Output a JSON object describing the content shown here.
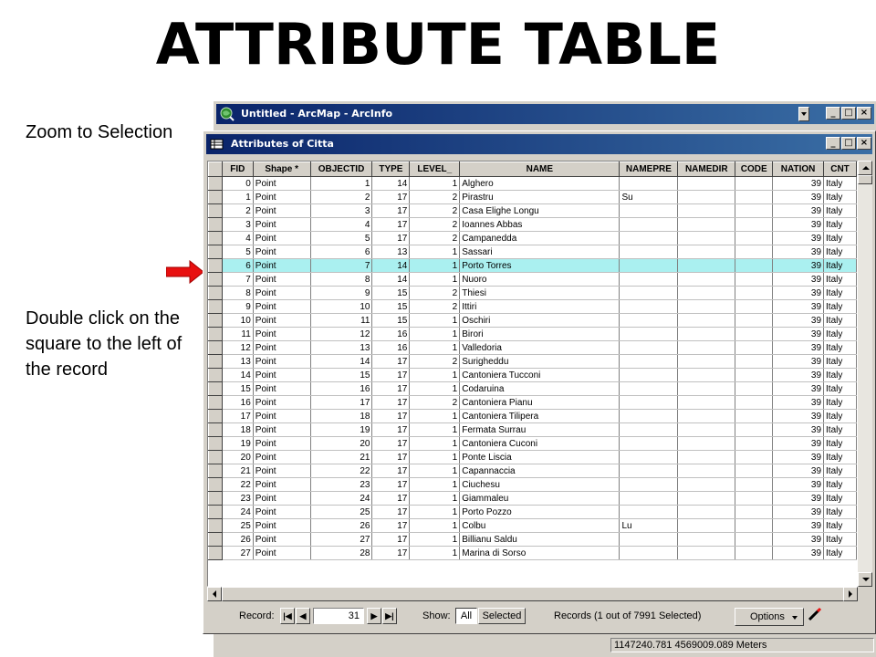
{
  "slide": {
    "title": "ATTRIBUTE TABLE",
    "note_zoom": "Zoom to Selection",
    "note_dblclick": "Double click on the square to the left of the record"
  },
  "arcmap": {
    "title": "Untitled - ArcMap - ArcInfo"
  },
  "attributes": {
    "title": "Attributes of Citta",
    "columns": [
      "FID",
      "Shape *",
      "OBJECTID",
      "TYPE",
      "LEVEL_",
      "NAME",
      "NAMEPRE",
      "NAMEDIR",
      "CODE",
      "NATION",
      "CNT"
    ],
    "rows": [
      [
        "0",
        "Point",
        "1",
        "14",
        "1",
        "Alghero",
        "",
        "",
        "",
        "39",
        "Italy"
      ],
      [
        "1",
        "Point",
        "2",
        "17",
        "2",
        "Pirastru",
        "Su",
        "",
        "",
        "39",
        "Italy"
      ],
      [
        "2",
        "Point",
        "3",
        "17",
        "2",
        "Casa Elighe Longu",
        "",
        "",
        "",
        "39",
        "Italy"
      ],
      [
        "3",
        "Point",
        "4",
        "17",
        "2",
        "Ioannes Abbas",
        "",
        "",
        "",
        "39",
        "Italy"
      ],
      [
        "4",
        "Point",
        "5",
        "17",
        "2",
        "Campanedda",
        "",
        "",
        "",
        "39",
        "Italy"
      ],
      [
        "5",
        "Point",
        "6",
        "13",
        "1",
        "Sassari",
        "",
        "",
        "",
        "39",
        "Italy"
      ],
      [
        "6",
        "Point",
        "7",
        "14",
        "1",
        "Porto Torres",
        "",
        "",
        "",
        "39",
        "Italy"
      ],
      [
        "7",
        "Point",
        "8",
        "14",
        "1",
        "Nuoro",
        "",
        "",
        "",
        "39",
        "Italy"
      ],
      [
        "8",
        "Point",
        "9",
        "15",
        "2",
        "Thiesi",
        "",
        "",
        "",
        "39",
        "Italy"
      ],
      [
        "9",
        "Point",
        "10",
        "15",
        "2",
        "Ittiri",
        "",
        "",
        "",
        "39",
        "Italy"
      ],
      [
        "10",
        "Point",
        "11",
        "15",
        "1",
        "Oschiri",
        "",
        "",
        "",
        "39",
        "Italy"
      ],
      [
        "11",
        "Point",
        "12",
        "16",
        "1",
        "Birori",
        "",
        "",
        "",
        "39",
        "Italy"
      ],
      [
        "12",
        "Point",
        "13",
        "16",
        "1",
        "Valledoria",
        "",
        "",
        "",
        "39",
        "Italy"
      ],
      [
        "13",
        "Point",
        "14",
        "17",
        "2",
        "Surigheddu",
        "",
        "",
        "",
        "39",
        "Italy"
      ],
      [
        "14",
        "Point",
        "15",
        "17",
        "1",
        "Cantoniera Tucconi",
        "",
        "",
        "",
        "39",
        "Italy"
      ],
      [
        "15",
        "Point",
        "16",
        "17",
        "1",
        "Codaruina",
        "",
        "",
        "",
        "39",
        "Italy"
      ],
      [
        "16",
        "Point",
        "17",
        "17",
        "2",
        "Cantoniera Pianu",
        "",
        "",
        "",
        "39",
        "Italy"
      ],
      [
        "17",
        "Point",
        "18",
        "17",
        "1",
        "Cantoniera Tilipera",
        "",
        "",
        "",
        "39",
        "Italy"
      ],
      [
        "18",
        "Point",
        "19",
        "17",
        "1",
        "Fermata Surrau",
        "",
        "",
        "",
        "39",
        "Italy"
      ],
      [
        "19",
        "Point",
        "20",
        "17",
        "1",
        "Cantoniera Cuconi",
        "",
        "",
        "",
        "39",
        "Italy"
      ],
      [
        "20",
        "Point",
        "21",
        "17",
        "1",
        "Ponte Liscia",
        "",
        "",
        "",
        "39",
        "Italy"
      ],
      [
        "21",
        "Point",
        "22",
        "17",
        "1",
        "Capannaccia",
        "",
        "",
        "",
        "39",
        "Italy"
      ],
      [
        "22",
        "Point",
        "23",
        "17",
        "1",
        "Ciuchesu",
        "",
        "",
        "",
        "39",
        "Italy"
      ],
      [
        "23",
        "Point",
        "24",
        "17",
        "1",
        "Giammaleu",
        "",
        "",
        "",
        "39",
        "Italy"
      ],
      [
        "24",
        "Point",
        "25",
        "17",
        "1",
        "Porto Pozzo",
        "",
        "",
        "",
        "39",
        "Italy"
      ],
      [
        "25",
        "Point",
        "26",
        "17",
        "1",
        "Colbu",
        "Lu",
        "",
        "",
        "39",
        "Italy"
      ],
      [
        "26",
        "Point",
        "27",
        "17",
        "1",
        "Billianu Saldu",
        "",
        "",
        "",
        "39",
        "Italy"
      ],
      [
        "27",
        "Point",
        "28",
        "17",
        "1",
        "Marina di Sorso",
        "",
        "",
        "",
        "39",
        "Italy"
      ]
    ],
    "highlighted_row": 6,
    "highlight_color": "#aaf0f0",
    "record_label": "Record:",
    "record_value": "31",
    "show_label": "Show:",
    "show_all": "All",
    "show_selected": "Selected",
    "records_info": "Records (1 out of 7991 Selected)",
    "options_label": "Options"
  },
  "statusbar": {
    "coords": "1147240.781  4569009.089 Meters"
  },
  "colors": {
    "titlebar": "#0a246a",
    "arrow": "#e81010"
  }
}
